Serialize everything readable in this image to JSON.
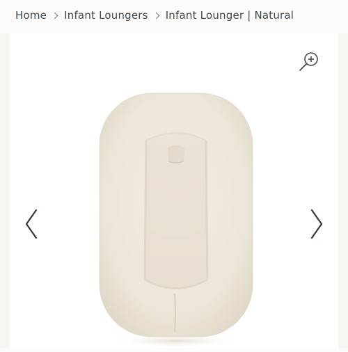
{
  "breadcrumb": {
    "items": [
      {
        "label": "Home"
      },
      {
        "label": "Infant Loungers"
      },
      {
        "label": "Infant Lounger | Natural"
      }
    ]
  },
  "gallery": {
    "zoom_icon": "zoom-in-icon",
    "prev_icon": "chevron-left-icon",
    "next_icon": "chevron-right-icon",
    "product_image": "infant-lounger-natural"
  },
  "colors": {
    "page_bg": "#fcfbf7",
    "text": "#3d4a52",
    "product": "#efe9dc"
  }
}
